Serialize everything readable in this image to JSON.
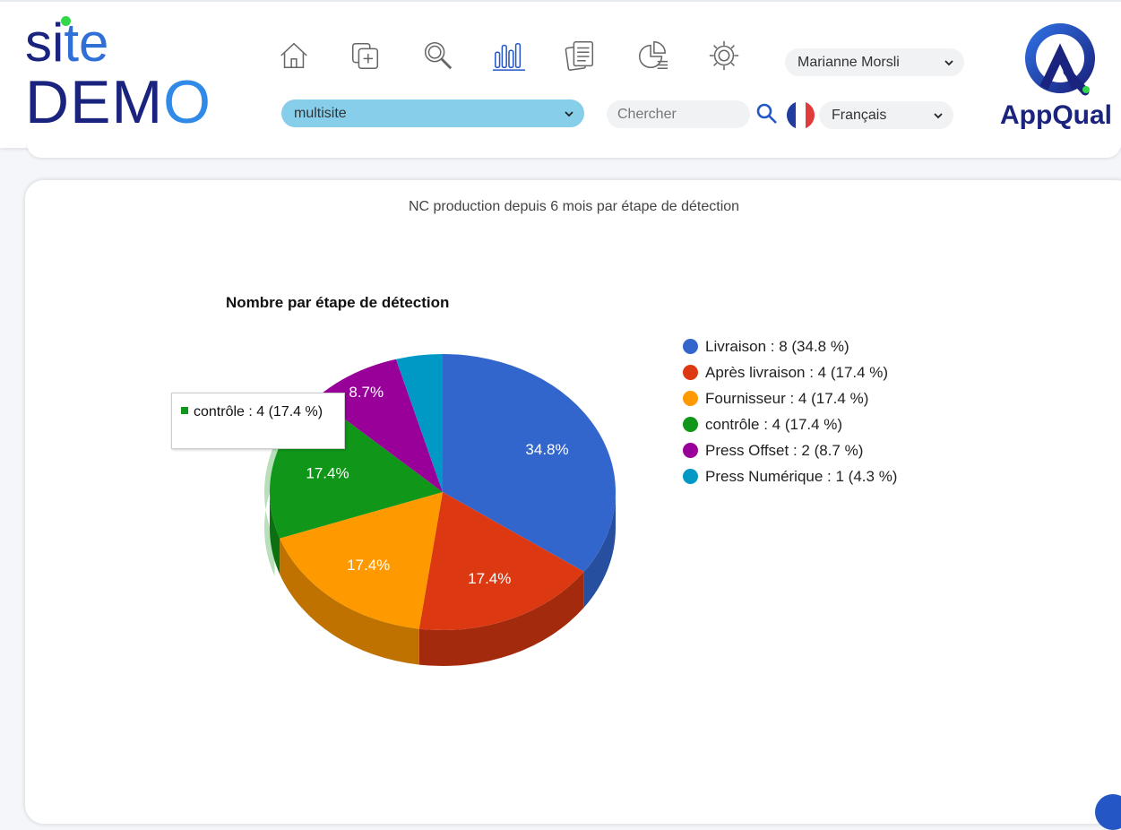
{
  "brand": {
    "line1_a": "si",
    "line1_b": "te",
    "line2_a": "DEM",
    "line2_b": "O"
  },
  "nav": {
    "icons": [
      "home-icon",
      "add-document-icon",
      "search-icon",
      "chart-bars-icon",
      "documents-icon",
      "pie-report-icon",
      "settings-icon"
    ],
    "user_select": "Marianne Morsli",
    "site_select": "multisite",
    "search_placeholder": "Chercher",
    "language_select": "Français"
  },
  "logo": {
    "text": "AppQual"
  },
  "card": {
    "title": "NC production depuis 6 mois par étape de détection"
  },
  "tooltip": {
    "text": "contrôle : 4 (17.4 %)"
  },
  "chart_data": {
    "type": "pie",
    "title": "Nombre par étape de détection",
    "labels": [
      "Livraison",
      "Après livraison",
      "Fournisseur",
      "contrôle",
      "Press Offset",
      "Press Numérique"
    ],
    "values": [
      8,
      4,
      4,
      4,
      2,
      1
    ],
    "percent_labels": [
      "34.8%",
      "17.4%",
      "17.4%",
      "17.4%",
      "8.7%",
      ""
    ],
    "legend_text": [
      "Livraison : 8 (34.8 %)",
      "Après livraison : 4 (17.4 %)",
      "Fournisseur : 4 (17.4 %)",
      "contrôle : 4 (17.4 %)",
      "Press Offset : 2 (8.7 %)",
      "Press Numérique : 1 (4.3 %)"
    ],
    "colors": [
      "#3366cc",
      "#dc3912",
      "#ff9900",
      "#109618",
      "#990099",
      "#0099c6"
    ],
    "side_colors": [
      "#26509f",
      "#a42a0d",
      "#bf7200",
      "#0c7012",
      "#730073",
      "#0073a0"
    ],
    "legend_position": "right",
    "style": "3d",
    "highlighted_slice": 3
  }
}
